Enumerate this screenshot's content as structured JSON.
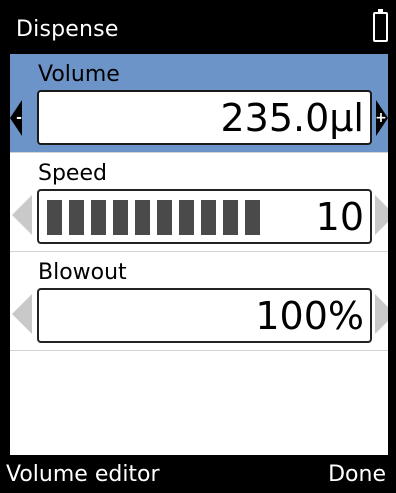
{
  "header": {
    "title": "Dispense",
    "battery_icon": "battery-icon"
  },
  "settings": [
    {
      "label": "Volume",
      "value": "235.0µl",
      "selected": true,
      "decrement_glyph": "-",
      "increment_glyph": "+"
    },
    {
      "label": "Speed",
      "value": "10",
      "level": 10,
      "level_max": 10,
      "selected": false
    },
    {
      "label": "Blowout",
      "value": "100%",
      "selected": false
    }
  ],
  "footer": {
    "left_softkey": "Volume editor",
    "right_softkey": "Done"
  },
  "colors": {
    "selection": "#6d94c8",
    "bar": "#4a4a4a",
    "background": "#ffffff",
    "chrome": "#000000"
  }
}
